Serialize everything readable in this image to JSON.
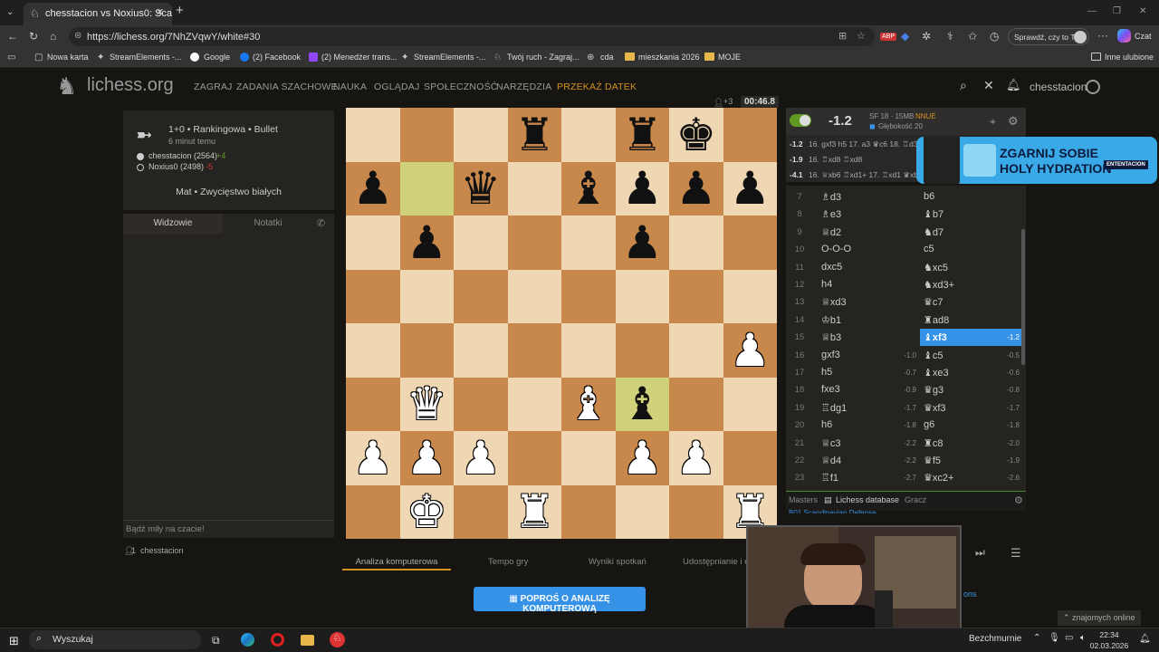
{
  "browser": {
    "tab_title": "chesstacion vs Noxius0: Scandinav",
    "url": "https://lichess.org/7NhZVqwY/white#30",
    "search_hint": "Sprawdź, czy to Ty",
    "copilot": "Czat",
    "bookmarks": [
      "Nowa karta",
      "StreamElements -...",
      "Google",
      "(2) Facebook",
      "(2) Menedżer trans...",
      "StreamElements -...",
      "Twój ruch - Zagraj...",
      "cda",
      "mieszkania 2026",
      "MOJE"
    ],
    "other_bookmarks": "Inne ulubione"
  },
  "site": {
    "logo": "lichess.org",
    "nav": [
      "ZAGRAJ",
      "ZADANIA SZACHOWE",
      "NAUKA",
      "OGLĄDAJ",
      "SPOŁECZNOŚĆ",
      "NARZĘDZIA"
    ],
    "donate": "PRZEKAŻ DATEK",
    "username": "chesstacion"
  },
  "game": {
    "type": "1+0 • Rankingowa • Bullet",
    "ago": "6 minut temu",
    "white": "chesstacion (2564)",
    "white_diff": "+4",
    "black": "Noxius0 (2498)",
    "black_diff": "-5",
    "result": "Mat • Zwycięstwo białych",
    "clock": "00:46.8",
    "viewers": "+3"
  },
  "chat": {
    "tab_spectators": "Widzowie",
    "tab_notes": "Notatki",
    "placeholder": "Bądź miły na czacie!",
    "spectator_count": "1",
    "spectator_name": "chesstacion"
  },
  "board": {
    "rows": [
      [
        "",
        "",
        "",
        "bR",
        "",
        "bR",
        "bK",
        ""
      ],
      [
        "bP",
        "",
        "bQ",
        "",
        "bB",
        "bP",
        "bP",
        "bP"
      ],
      [
        "",
        "bP",
        "",
        "",
        "",
        "bP",
        "",
        ""
      ],
      [
        "",
        "",
        "",
        "",
        "",
        "",
        "",
        ""
      ],
      [
        "",
        "",
        "",
        "",
        "",
        "",
        "",
        "wP"
      ],
      [
        "",
        "wQ",
        "",
        "",
        "wB",
        "bB",
        "",
        ""
      ],
      [
        "wP",
        "wP",
        "wP",
        "",
        "",
        "wP",
        "wP",
        ""
      ],
      [
        "",
        "wK",
        "",
        "wR",
        "",
        "",
        "",
        "wR"
      ]
    ],
    "highlight": [
      [
        1,
        1
      ],
      [
        5,
        5
      ]
    ]
  },
  "engine": {
    "eval": "-1.2",
    "info": "SF 18 · 15MB",
    "nnue": "NNUE",
    "depth": "Głębokość 20",
    "pv1_eval": "-1.2",
    "pv1": "16. gxf3 h5 17. a3 ♛c6 18. ♖d3",
    "pv2_eval": "-1.9",
    "pv2": "16. ♖xd8 ♖xd8",
    "pv3_eval": "-4.1",
    "pv3": "16. ♕xb6 ♖xd1+ 17. ♖xd1 ♛xb6"
  },
  "moves": [
    {
      "n": "7",
      "w": "♗d3",
      "ws": "",
      "b": "b6",
      "bs": ""
    },
    {
      "n": "8",
      "w": "♗e3",
      "ws": "",
      "b": "♝b7",
      "bs": ""
    },
    {
      "n": "9",
      "w": "♕d2",
      "ws": "",
      "b": "♞d7",
      "bs": ""
    },
    {
      "n": "10",
      "w": "O-O-O",
      "ws": "",
      "b": "c5",
      "bs": ""
    },
    {
      "n": "11",
      "w": "dxc5",
      "ws": "",
      "b": "♞xc5",
      "bs": ""
    },
    {
      "n": "12",
      "w": "h4",
      "ws": "",
      "b": "♞xd3+",
      "bs": ""
    },
    {
      "n": "13",
      "w": "♕xd3",
      "ws": "",
      "b": "♛c7",
      "bs": ""
    },
    {
      "n": "14",
      "w": "♔b1",
      "ws": "",
      "b": "♜ad8",
      "bs": ""
    },
    {
      "n": "15",
      "w": "♕b3",
      "ws": "",
      "b": "♝xf3",
      "bs": "-1.2",
      "sel": true
    },
    {
      "n": "16",
      "w": "gxf3",
      "ws": "-1.0",
      "b": "♝c5",
      "bs": "-0.5"
    },
    {
      "n": "17",
      "w": "h5",
      "ws": "-0.7",
      "b": "♝xe3",
      "bs": "-0.6"
    },
    {
      "n": "18",
      "w": "fxe3",
      "ws": "-0.9",
      "b": "♛g3",
      "bs": "-0.8"
    },
    {
      "n": "19",
      "w": "♖dg1",
      "ws": "-1.7",
      "b": "♛xf3",
      "bs": "-1.7"
    },
    {
      "n": "20",
      "w": "h6",
      "ws": "-1.8",
      "b": "g6",
      "bs": "-1.8"
    },
    {
      "n": "21",
      "w": "♕c3",
      "ws": "-2.2",
      "b": "♜c8",
      "bs": "-2.0"
    },
    {
      "n": "22",
      "w": "♕d4",
      "ws": "-2.2",
      "b": "♛f5",
      "bs": "-1.9"
    },
    {
      "n": "23",
      "w": "♖f1",
      "ws": "-2.7",
      "b": "♛xc2+",
      "bs": "-2.6"
    }
  ],
  "explorer": {
    "tabs": [
      "Masters",
      "Lichess database",
      "Gracz"
    ],
    "opening": "B01 Scandinavian Defense"
  },
  "under_board": {
    "tabs": [
      "Analiza komputerowa",
      "Tempo gry",
      "Wyniki spotkań",
      "Udostępnianie i ek"
    ],
    "request_button": "POPROŚ O ANALIZĘ KOMPUTEROWĄ"
  },
  "ad": {
    "line1": "ZGARNIJ SOBIE",
    "line2": "HOLY HYDRATION",
    "badge": "ENTENTACION"
  },
  "friends": "znajomych online",
  "taskbar": {
    "search": "Wyszukaj",
    "weather": "Bezchmurnie",
    "time": "22:34",
    "date": "02.03.2026"
  }
}
